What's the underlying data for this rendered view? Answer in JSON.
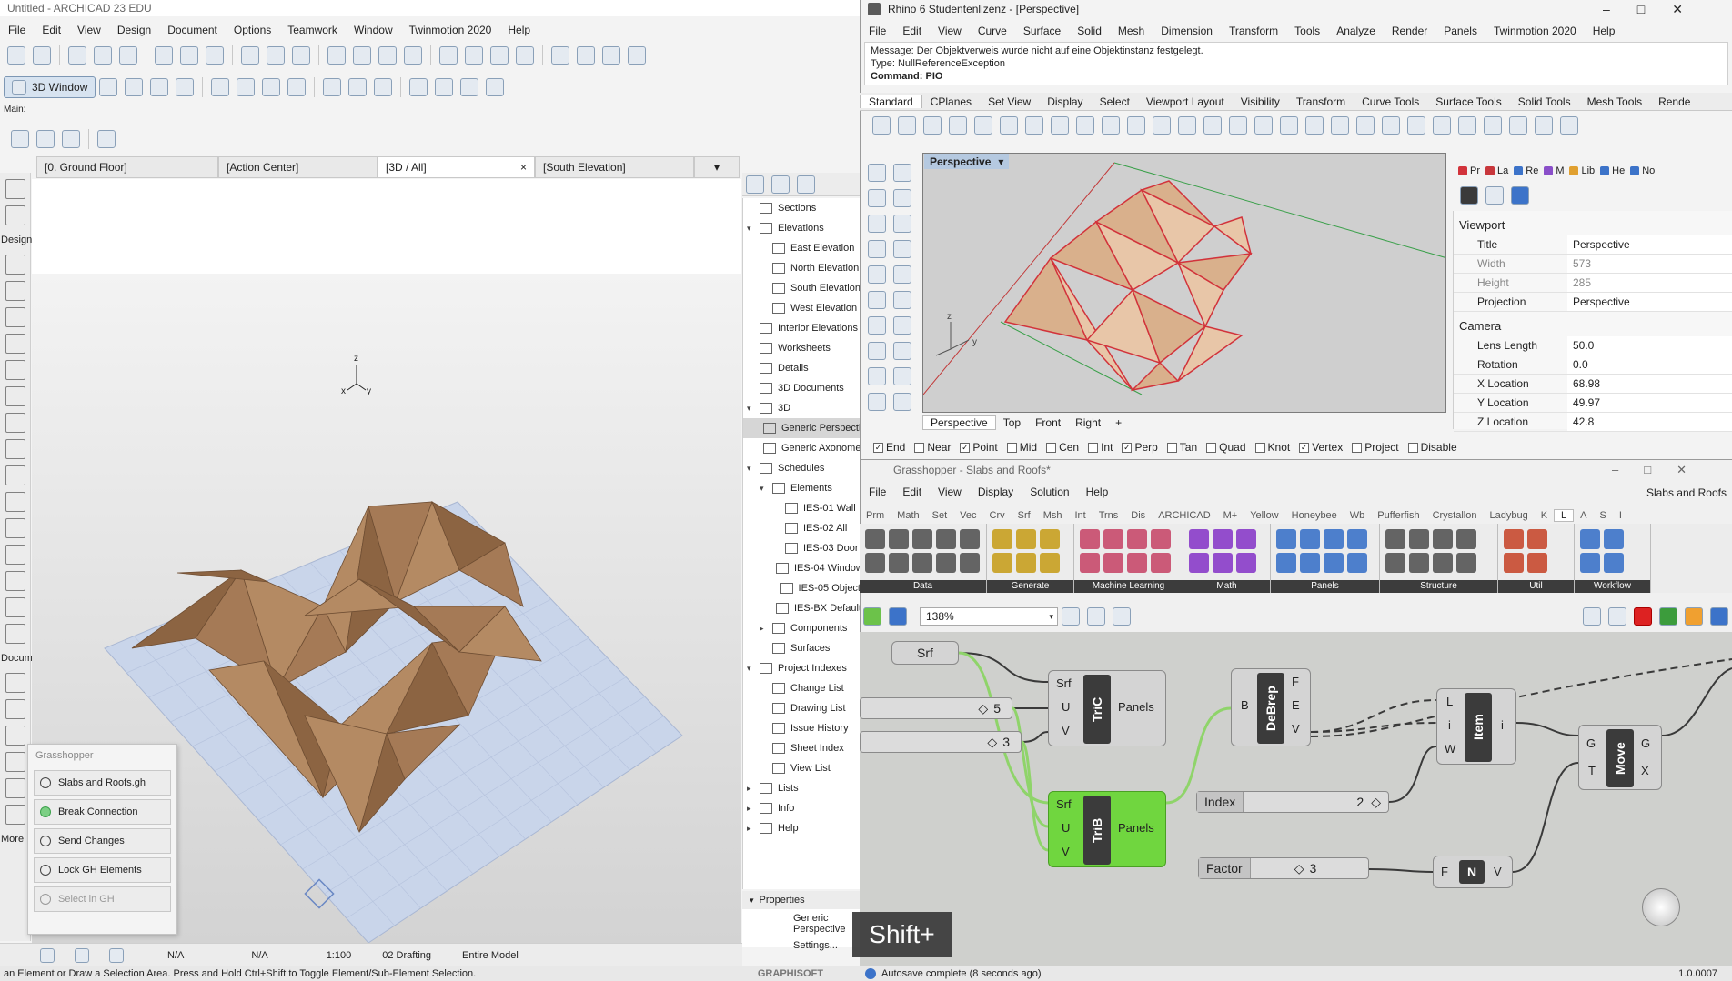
{
  "archicad": {
    "title": "Untitled - ARCHICAD 23 EDU",
    "menu": [
      "File",
      "Edit",
      "View",
      "Design",
      "Document",
      "Options",
      "Teamwork",
      "Window",
      "Twinmotion 2020",
      "Help"
    ],
    "toolbar_3d_label": "3D Window",
    "main_label": "Main:",
    "tabs": [
      "[0. Ground Floor]",
      "[Action Center]",
      "[3D / All]",
      "[South Elevation]"
    ],
    "left_sections": [
      "Design",
      "Docum",
      "More"
    ],
    "navigator": [
      {
        "label": "Sections",
        "indent": 1,
        "caret": ""
      },
      {
        "label": "Elevations",
        "indent": 1,
        "caret": "v"
      },
      {
        "label": "East Elevation",
        "indent": 2,
        "caret": ""
      },
      {
        "label": "North Elevation",
        "indent": 2,
        "caret": ""
      },
      {
        "label": "South Elevation",
        "indent": 2,
        "caret": ""
      },
      {
        "label": "West Elevation",
        "indent": 2,
        "caret": ""
      },
      {
        "label": "Interior Elevations",
        "indent": 1,
        "caret": ""
      },
      {
        "label": "Worksheets",
        "indent": 1,
        "caret": ""
      },
      {
        "label": "Details",
        "indent": 1,
        "caret": ""
      },
      {
        "label": "3D Documents",
        "indent": 1,
        "caret": ""
      },
      {
        "label": "3D",
        "indent": 1,
        "caret": "v"
      },
      {
        "label": "Generic Perspective",
        "indent": 2,
        "caret": "",
        "selected": true
      },
      {
        "label": "Generic Axonometry",
        "indent": 2,
        "caret": ""
      },
      {
        "label": "Schedules",
        "indent": 1,
        "caret": "v"
      },
      {
        "label": "Elements",
        "indent": 2,
        "caret": "v"
      },
      {
        "label": "IES-01 Wall",
        "indent": 3,
        "caret": ""
      },
      {
        "label": "IES-02 All",
        "indent": 3,
        "caret": ""
      },
      {
        "label": "IES-03 Door",
        "indent": 3,
        "caret": ""
      },
      {
        "label": "IES-04 Window",
        "indent": 3,
        "caret": ""
      },
      {
        "label": "IES-05 Object",
        "indent": 3,
        "caret": ""
      },
      {
        "label": "IES-BX Default",
        "indent": 3,
        "caret": ""
      },
      {
        "label": "Components",
        "indent": 2,
        "caret": ">"
      },
      {
        "label": "Surfaces",
        "indent": 2,
        "caret": ""
      },
      {
        "label": "Project Indexes",
        "indent": 1,
        "caret": "v"
      },
      {
        "label": "Change List",
        "indent": 2,
        "caret": ""
      },
      {
        "label": "Drawing List",
        "indent": 2,
        "caret": ""
      },
      {
        "label": "Issue History",
        "indent": 2,
        "caret": ""
      },
      {
        "label": "Sheet Index",
        "indent": 2,
        "caret": ""
      },
      {
        "label": "View List",
        "indent": 2,
        "caret": ""
      },
      {
        "label": "Lists",
        "indent": 1,
        "caret": ">"
      },
      {
        "label": "Info",
        "indent": 1,
        "caret": ">"
      },
      {
        "label": "Help",
        "indent": 1,
        "caret": ">"
      }
    ],
    "properties_label": "Properties",
    "properties_rows": [
      "Generic Perspective",
      "Settings..."
    ],
    "gh_palette": {
      "title": "Grasshopper",
      "buttons": [
        "Slabs and Roofs.gh",
        "Break Connection",
        "Send Changes",
        "Lock GH Elements",
        "Select in GH"
      ]
    },
    "bottom_bar": {
      "na1": "N/A",
      "na2": "N/A",
      "scale": "1:100",
      "pen": "02 Drafting",
      "model": "Entire Model"
    },
    "status": "an Element or Draw a Selection Area. Press and Hold Ctrl+Shift to Toggle Element/Sub-Element Selection.",
    "brand": "GRAPHISOFT",
    "axis_z": "z",
    "axis_x": "x",
    "axis_y": "y"
  },
  "rhino": {
    "title": "Rhino 6 Studentenlizenz - [Perspective]",
    "menu": [
      "File",
      "Edit",
      "View",
      "Curve",
      "Surface",
      "Solid",
      "Mesh",
      "Dimension",
      "Transform",
      "Tools",
      "Analyze",
      "Render",
      "Panels",
      "Twinmotion 2020",
      "Help"
    ],
    "message1": "Message: Der Objektverweis wurde nicht auf eine Objektinstanz festgelegt.",
    "message2": "Type: NullReferenceException",
    "command": "Command: PIO",
    "tabs": [
      "Standard",
      "CPlanes",
      "Set View",
      "Display",
      "Select",
      "Viewport Layout",
      "Visibility",
      "Transform",
      "Curve Tools",
      "Surface Tools",
      "Solid Tools",
      "Mesh Tools",
      "Rende"
    ],
    "viewport_label": "Perspective",
    "viewport_tabs": [
      "Perspective",
      "Top",
      "Front",
      "Right"
    ],
    "osnaps": [
      {
        "label": "End",
        "checked": true
      },
      {
        "label": "Near",
        "checked": false
      },
      {
        "label": "Point",
        "checked": true
      },
      {
        "label": "Mid",
        "checked": false
      },
      {
        "label": "Cen",
        "checked": false
      },
      {
        "label": "Int",
        "checked": false
      },
      {
        "label": "Perp",
        "checked": true
      },
      {
        "label": "Tan",
        "checked": false
      },
      {
        "label": "Quad",
        "checked": false
      },
      {
        "label": "Knot",
        "checked": false
      },
      {
        "label": "Vertex",
        "checked": true
      },
      {
        "label": "Project",
        "checked": false
      },
      {
        "label": "Disable",
        "checked": false
      }
    ],
    "panel_tabs": [
      "Pr",
      "La",
      "Re",
      "M",
      "Lib",
      "He",
      "No"
    ],
    "properties": {
      "viewport_head": "Viewport",
      "viewport_rows": [
        {
          "k": "Title",
          "v": "Perspective",
          "dim": false
        },
        {
          "k": "Width",
          "v": "573",
          "dim": true
        },
        {
          "k": "Height",
          "v": "285",
          "dim": true
        },
        {
          "k": "Projection",
          "v": "Perspective",
          "dim": false
        }
      ],
      "camera_head": "Camera",
      "camera_rows": [
        {
          "k": "Lens Length",
          "v": "50.0",
          "dim": false
        },
        {
          "k": "Rotation",
          "v": "0.0",
          "dim": false
        },
        {
          "k": "X Location",
          "v": "68.98",
          "dim": false
        },
        {
          "k": "Y Location",
          "v": "49.97",
          "dim": false
        },
        {
          "k": "Z Location",
          "v": "42.8",
          "dim": false
        }
      ]
    },
    "axis_z": "z",
    "axis_y": "y"
  },
  "grasshopper": {
    "title": "Grasshopper - Slabs and Roofs*",
    "menu": [
      "File",
      "Edit",
      "View",
      "Display",
      "Solution",
      "Help"
    ],
    "doc_name": "Slabs and Roofs",
    "tabs": [
      "Prm",
      "Math",
      "Set",
      "Vec",
      "Crv",
      "Srf",
      "Msh",
      "Int",
      "Trns",
      "Dis",
      "ARCHICAD",
      "M+",
      "Yellow",
      "Honeybee",
      "Wb",
      "Pufferfish",
      "Crystallon",
      "Ladybug",
      "K",
      "L",
      "A",
      "S",
      "I"
    ],
    "ribbon_groups": [
      "Data",
      "Generate",
      "Machine Learning",
      "Math",
      "Panels",
      "Structure",
      "Util",
      "Workflow"
    ],
    "zoom": "138%",
    "version": "1.0.0007",
    "status": "Autosave complete (8 seconds ago)",
    "components": {
      "srf_param": "Srf",
      "slider_u": "5",
      "slider_v": "3",
      "tric": {
        "name": "TriC",
        "in": [
          "Srf",
          "U",
          "V"
        ],
        "out": "Panels"
      },
      "trib": {
        "name": "TriB",
        "in": [
          "Srf",
          "U",
          "V"
        ],
        "out": "Panels"
      },
      "debrep": {
        "name": "DeBrep",
        "in": "B",
        "out": [
          "F",
          "E",
          "V"
        ]
      },
      "item": {
        "name": "Item",
        "in": [
          "L",
          "i",
          "W"
        ],
        "out": "i"
      },
      "move": {
        "name": "Move",
        "in": [
          "G",
          "T"
        ],
        "out": [
          "G",
          "X"
        ]
      },
      "index_slider": {
        "label": "Index",
        "value": "2"
      },
      "factor_slider": {
        "label": "Factor",
        "value": "3"
      },
      "neg": {
        "name": "N",
        "in": "F",
        "out": "V"
      }
    }
  },
  "caption": "Shift+",
  "colors": {
    "gh_green": "#70d63f",
    "wood": "#a57a56",
    "rhino_red": "#d2333b"
  }
}
